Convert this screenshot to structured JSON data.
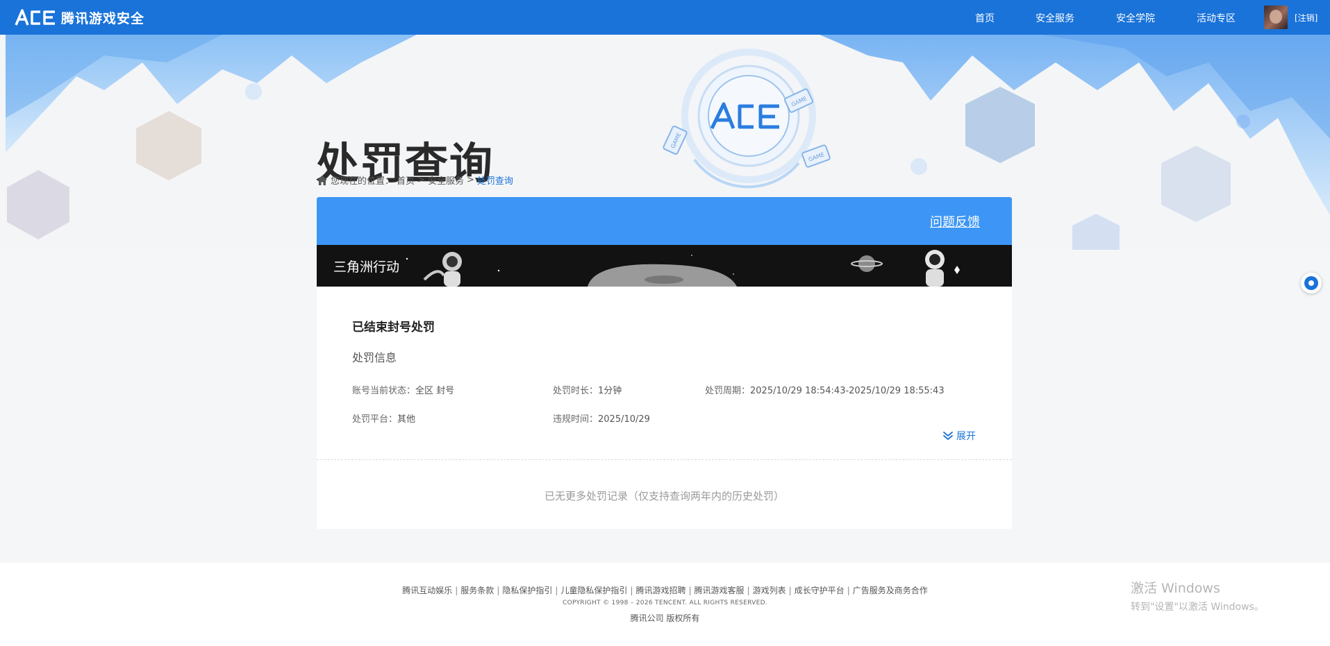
{
  "brand": {
    "logo_text": "腾讯游戏安全",
    "logo_mark_text": "ACE"
  },
  "nav": {
    "items": [
      {
        "label": "首页"
      },
      {
        "label": "安全服务"
      },
      {
        "label": "安全学院"
      },
      {
        "label": "活动专区"
      }
    ],
    "logout_label": "[注销]"
  },
  "page": {
    "title": "处罚查询",
    "emblem_text": "ACE",
    "badge_text": "GAME"
  },
  "breadcrumb": {
    "prefix": "您现在的位置：",
    "items": [
      "首页",
      "安全服务",
      "处罚查询"
    ],
    "separator": ">"
  },
  "card": {
    "feedback_label": "问题反馈",
    "game_name": "三角洲行动",
    "record": {
      "title": "已结束封号处罚",
      "section_label": "处罚信息",
      "fields": [
        {
          "label": "账号当前状态：",
          "value": "全区 封号"
        },
        {
          "label": "处罚时长：",
          "value": "1分钟"
        },
        {
          "label": "处罚周期：",
          "value": "2025/10/29 18:54:43-2025/10/29 18:55:43"
        },
        {
          "label": "处罚平台：",
          "value": "其他"
        },
        {
          "label": "违规时间：",
          "value": "2025/10/29"
        }
      ],
      "expand_label": "展开"
    },
    "no_more_text": "已无更多处罚记录（仅支持查询两年内的历史处罚）"
  },
  "footer": {
    "links": [
      "腾讯互动娱乐",
      "服务条款",
      "隐私保护指引",
      "儿童隐私保护指引",
      "腾讯游戏招聘",
      "腾讯游戏客服",
      "游戏列表",
      "成长守护平台",
      "广告服务及商务合作"
    ],
    "link_separator": "|",
    "copyright": "COPYRIGHT © 1998 – 2026 TENCENT. ALL RIGHTS RESERVED.",
    "company": "腾讯公司 版权所有"
  },
  "watermark": {
    "line1": "激活 Windows",
    "line2": "转到\"设置\"以激活 Windows。"
  },
  "colors": {
    "nav_bg": "#1a73d9",
    "card_header_bg": "#3d96f5",
    "link_blue": "#1a73d9"
  },
  "icons": {
    "home": "home-icon",
    "expand": "double-chevron-down-icon",
    "float": "chat-bubble-icon"
  }
}
